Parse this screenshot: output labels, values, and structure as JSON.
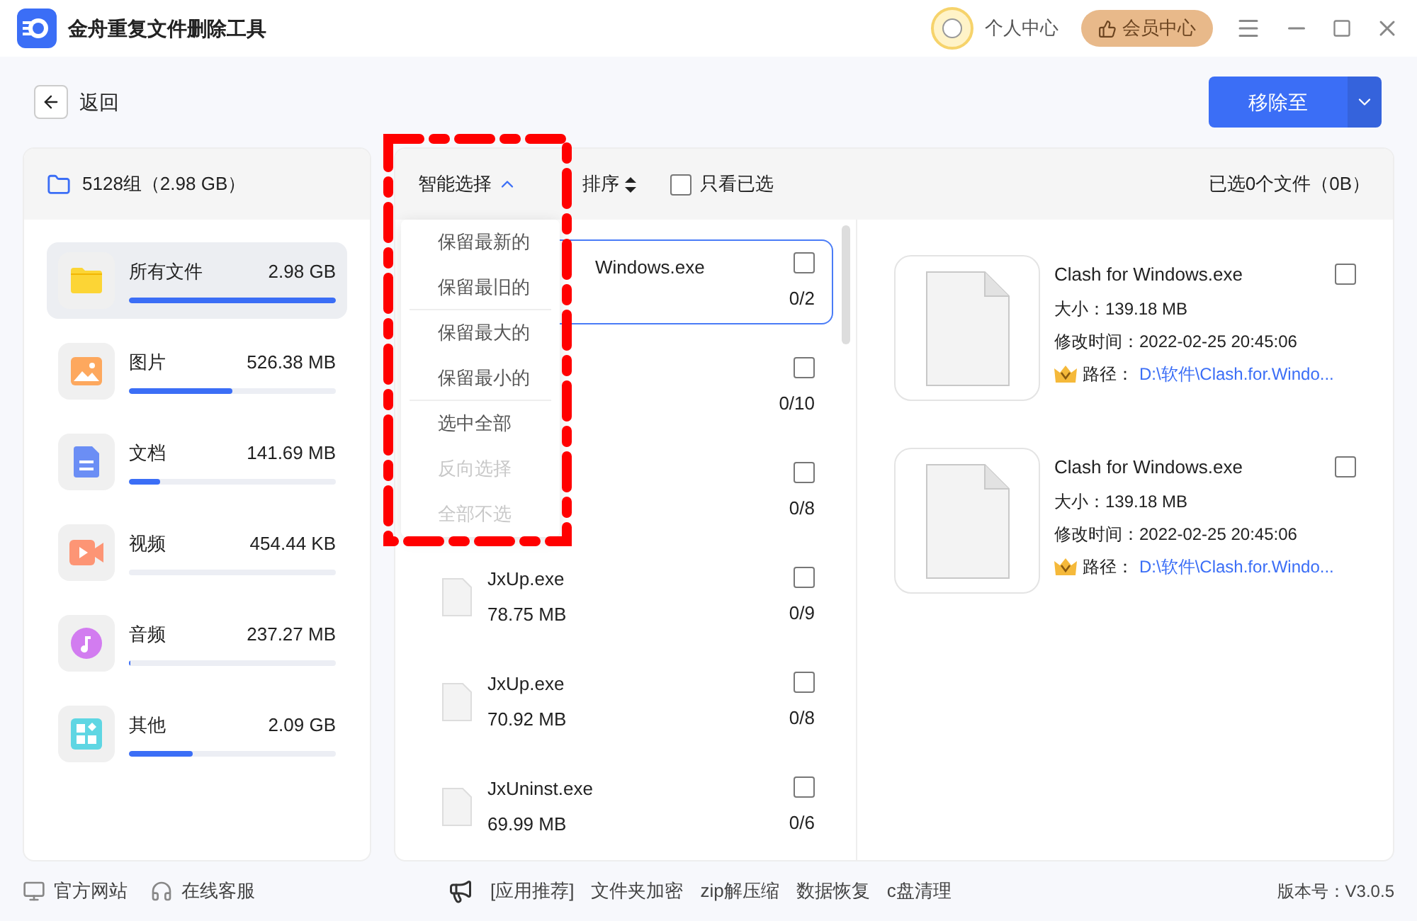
{
  "window": {
    "title": "金舟重复文件删除工具",
    "user_center": "个人中心",
    "member_center": "会员中心"
  },
  "toolbar": {
    "back": "返回",
    "move_button": "移除至"
  },
  "sidebar": {
    "header": "5128组（2.98 GB）",
    "items": [
      {
        "kind": "folder",
        "label": "所有文件",
        "size": "2.98 GB",
        "level": 1,
        "selected": true
      },
      {
        "kind": "image",
        "label": "图片",
        "size": "526.38 MB",
        "level": 0.5,
        "selected": false
      },
      {
        "kind": "document",
        "label": "文档",
        "size": "141.69 MB",
        "level": 0.15,
        "selected": false
      },
      {
        "kind": "video",
        "label": "视频",
        "size": "454.44 KB",
        "level": 0,
        "selected": false
      },
      {
        "kind": "audio",
        "label": "音频",
        "size": "237.27 MB",
        "level": 0.005,
        "selected": false
      },
      {
        "kind": "other",
        "label": "其他",
        "size": "2.09 GB",
        "level": 0.31,
        "selected": false
      }
    ]
  },
  "list_header": {
    "smart_select": "智能选择",
    "sort": "排序",
    "only_selected": {
      "label": "只看已选",
      "checked": false
    },
    "summary": "已选0个文件（0B）"
  },
  "smart_menu": {
    "expanded": true,
    "items": [
      {
        "label": "保留最新的",
        "disabled": false,
        "divider_after": false
      },
      {
        "label": "保留最旧的",
        "disabled": false,
        "divider_after": true
      },
      {
        "label": "保留最大的",
        "disabled": false,
        "divider_after": false
      },
      {
        "label": "保留最小的",
        "disabled": false,
        "divider_after": true
      },
      {
        "label": "选中全部",
        "disabled": false,
        "divider_after": false
      },
      {
        "label": "反向选择",
        "disabled": true,
        "divider_after": false
      },
      {
        "label": "全部不选",
        "disabled": true,
        "divider_after": false
      }
    ]
  },
  "groups": [
    {
      "name": "Windows.exe",
      "count": "0/2",
      "checked": false,
      "selected": true
    },
    {
      "count": "0/10",
      "checked": false,
      "selected": false
    },
    {
      "count": "0/8",
      "checked": false,
      "selected": false
    },
    {
      "name": "JxUp.exe",
      "size": "78.75 MB",
      "count": "0/9",
      "checked": false,
      "selected": false
    },
    {
      "name": "JxUp.exe",
      "size": "70.92 MB",
      "count": "0/8",
      "checked": false,
      "selected": false
    },
    {
      "name": "JxUninst.exe",
      "size": "69.99 MB",
      "count": "0/6",
      "checked": false,
      "selected": false
    }
  ],
  "files": [
    {
      "name": "Clash for Windows.exe",
      "size": "大小：139.18 MB",
      "modified": "修改时间：2022-02-25 20:45:06",
      "path_label": "路径：",
      "path": "D:\\软件\\Clash.for.Windo...",
      "checked": false
    },
    {
      "name": "Clash for Windows.exe",
      "size": "大小：139.18 MB",
      "modified": "修改时间：2022-02-25 20:45:06",
      "path_label": "路径：",
      "path": "D:\\软件\\Clash.for.Windo...",
      "checked": false
    }
  ],
  "footer": {
    "links": [
      "官方网站",
      "在线客服"
    ],
    "recommend": [
      "[应用推荐]",
      "文件夹加密",
      "zip解压缩",
      "数据恢复",
      "c盘清理"
    ],
    "version": "版本号：V3.0.5"
  }
}
